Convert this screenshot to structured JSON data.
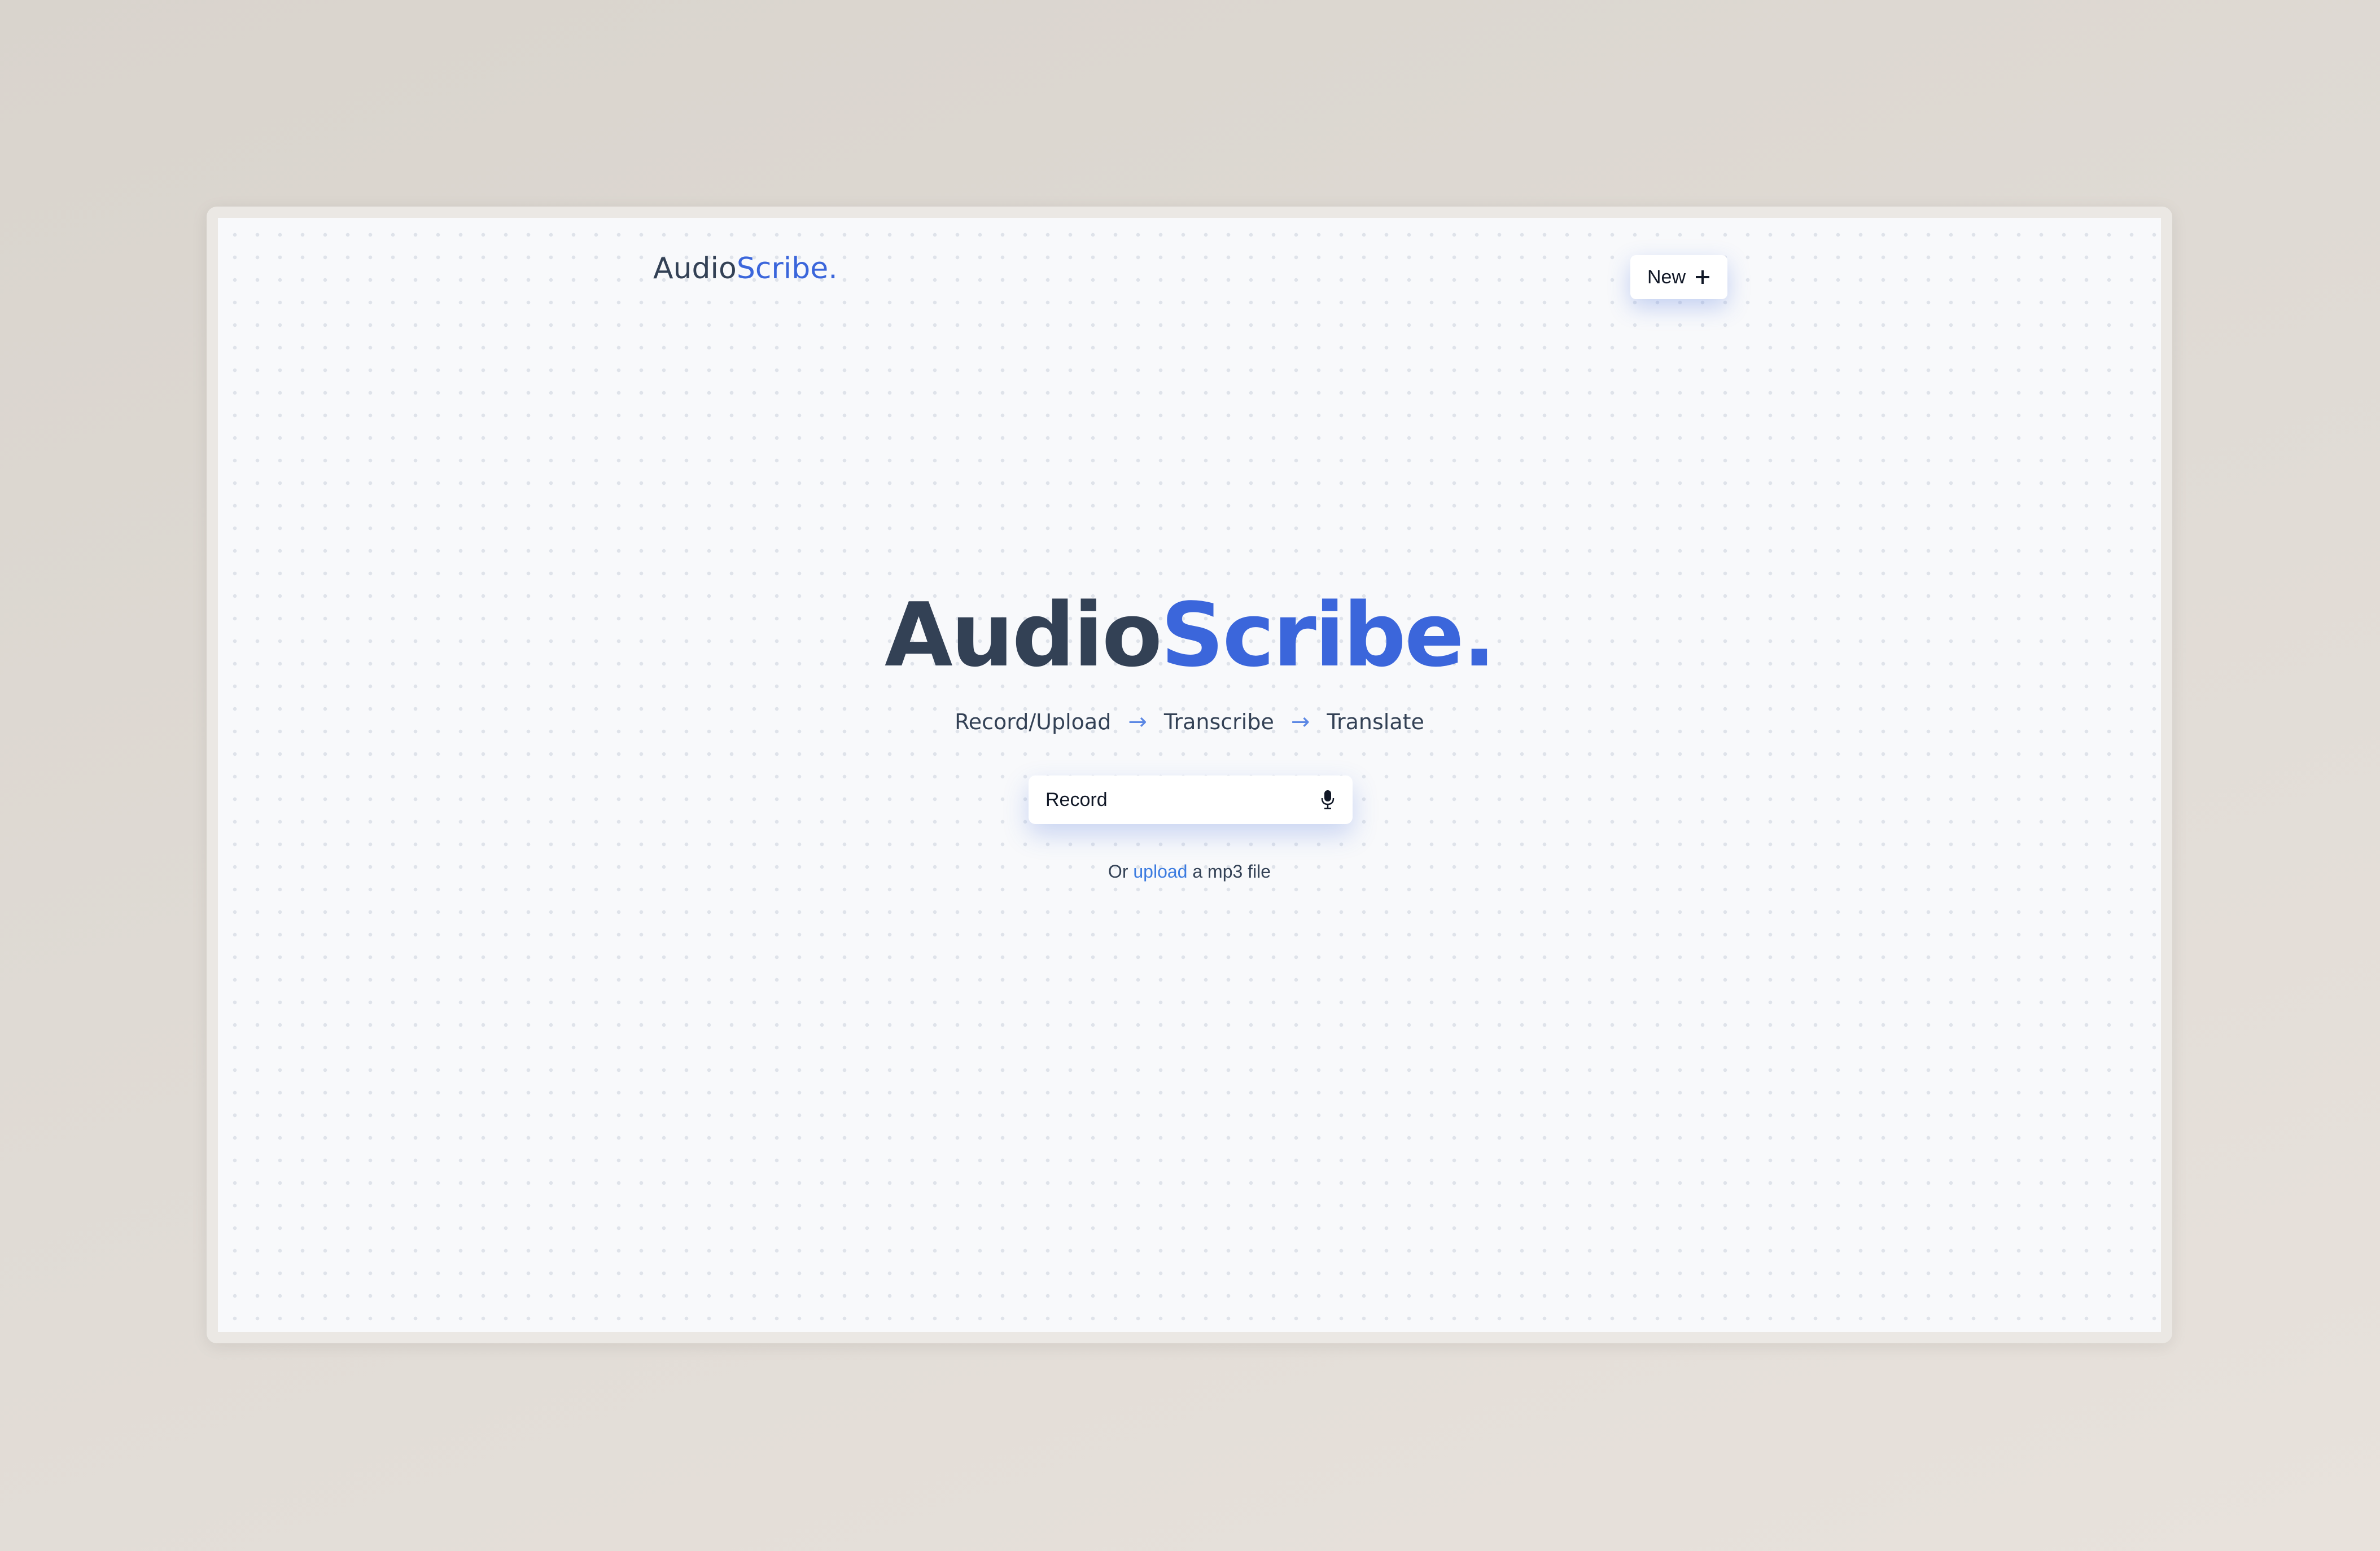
{
  "header": {
    "logo_part1": "Audio",
    "logo_part2": "Scribe."
  },
  "new_button": {
    "label": "New",
    "icon": "plus-icon"
  },
  "hero": {
    "title_part1": "Audio",
    "title_part2": "Scribe.",
    "steps": [
      "Record/Upload",
      "Transcribe",
      "Translate"
    ],
    "arrow": "→"
  },
  "record": {
    "label": "Record",
    "icon": "microphone-icon"
  },
  "upload_line": {
    "prefix": "Or",
    "link": "upload",
    "suffix": "a mp3 file"
  },
  "colors": {
    "accent": "#3b66db",
    "text": "#334155"
  }
}
